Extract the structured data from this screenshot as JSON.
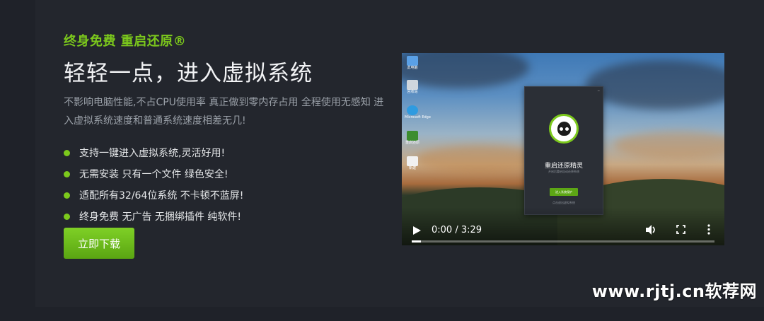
{
  "hero": {
    "tagline": "终身免费 重启还原®",
    "headline": "轻轻一点，进入虚拟系统",
    "description": "不影响电脑性能,不占CPU使用率 真正做到零内存占用 全程使用无感知 进入虚拟系统速度和普通系统速度相差无几!",
    "features": [
      "支持一键进入虚拟系统,灵活好用!",
      "无需安装 只有一个文件 绿色安全!",
      "适配所有32/64位系统 不卡顿不蓝屏!",
      "终身免费 无广告 无捆绑插件 纯软件!"
    ],
    "download_label": "立即下载"
  },
  "video": {
    "current_time": "0:00",
    "duration": "3:29",
    "time_display": "0:00 / 3:29",
    "progress_fraction": 0.03,
    "desktop_icons": [
      "此电脑",
      "回收站",
      "Microsoft Edge",
      "重启还原",
      "新建"
    ],
    "app": {
      "title": "重启还原精灵",
      "subtitle": "开启后重启自动还原系统",
      "button": "进入系统保护",
      "link": "点击退出虚拟系统"
    }
  },
  "colors": {
    "accent": "#7cc91c",
    "background": "#23262d",
    "text": "#f2f3f5"
  },
  "watermark": "www.rjtj.cn软荐网"
}
